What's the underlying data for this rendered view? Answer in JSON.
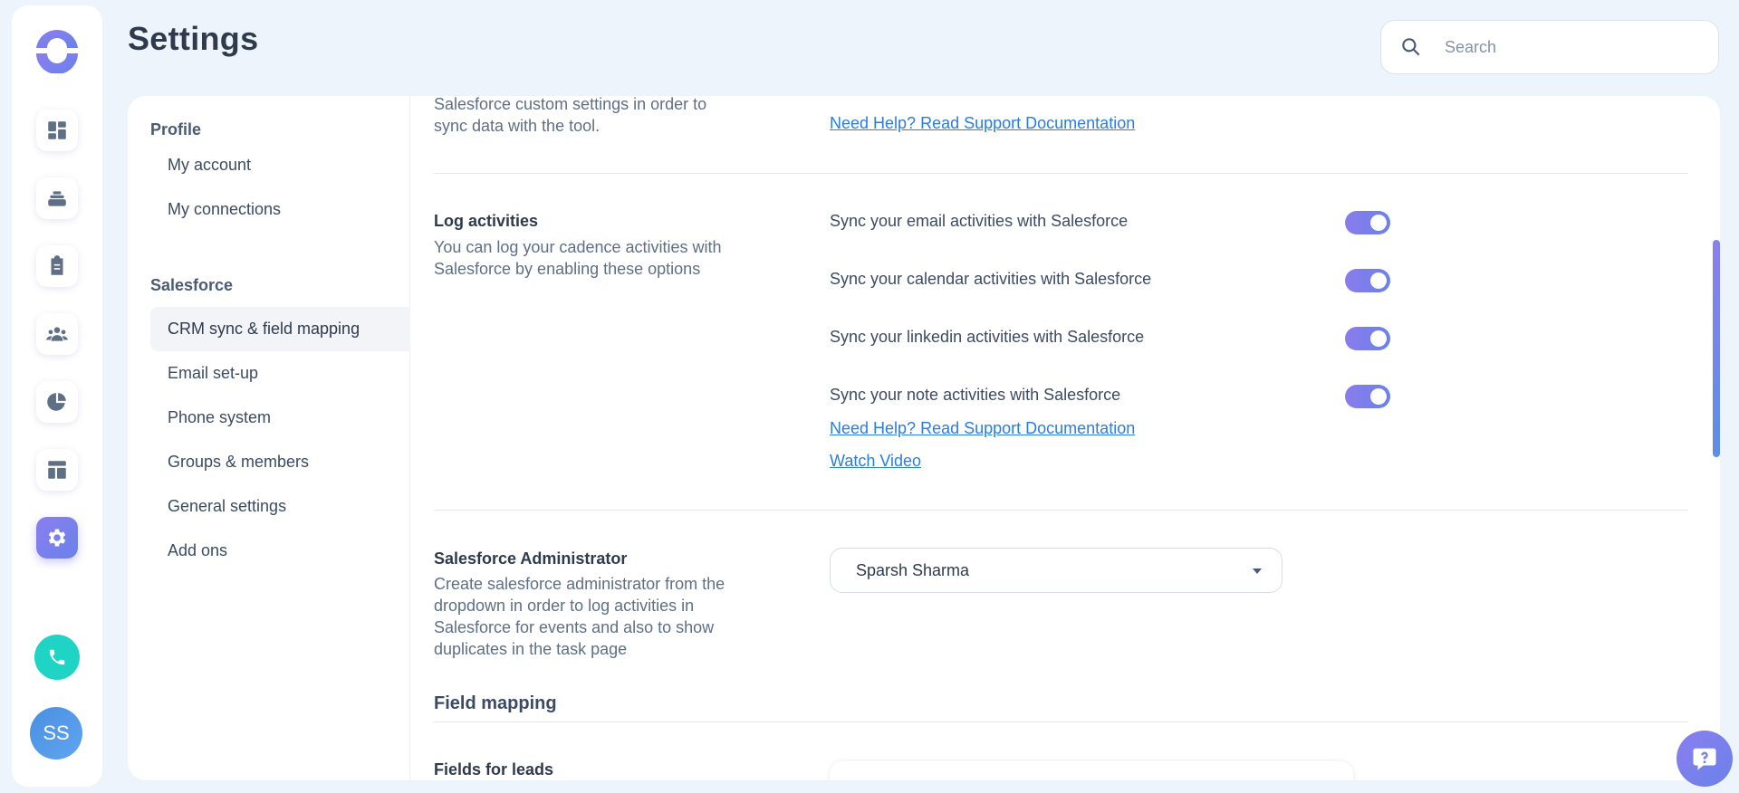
{
  "header": {
    "title": "Settings",
    "search_placeholder": "Search"
  },
  "rail": {
    "icons": [
      "dashboard-icon",
      "cadence-icon",
      "tasks-icon",
      "people-icon",
      "reports-icon",
      "templates-icon",
      "settings-icon"
    ],
    "active": "settings-icon",
    "avatar_initials": "SS",
    "accent": "#7b80ec",
    "phone_color": "#1fd4c5"
  },
  "subnav": {
    "profile_heading": "Profile",
    "profile_items": [
      "My account",
      "My connections"
    ],
    "salesforce_heading": "Salesforce",
    "salesforce_items": [
      "CRM sync & field mapping",
      "Email set-up",
      "Phone system",
      "Groups & members",
      "General settings",
      "Add ons"
    ],
    "active_item": "CRM sync & field mapping"
  },
  "content": {
    "top_desc": "Salesforce custom settings in order to sync data with the tool.",
    "top_link": "Need Help? Read Support Documentation",
    "log_activities": {
      "title": "Log activities",
      "desc": "You can log your cadence activities with Salesforce by enabling these options",
      "options": [
        {
          "label": "Sync your email activities with Salesforce",
          "enabled": true
        },
        {
          "label": "Sync your calendar activities with Salesforce",
          "enabled": true
        },
        {
          "label": "Sync your linkedin activities with Salesforce",
          "enabled": true
        },
        {
          "label": "Sync your note activities with Salesforce",
          "enabled": true
        }
      ],
      "help_link": "Need Help? Read Support Documentation",
      "video_link": "Watch Video"
    },
    "admin": {
      "title": "Salesforce Administrator",
      "desc": "Create salesforce administrator from the dropdown in order to log activities in Salesforce for events and also to show duplicates in the task page",
      "selected": "Sparsh Sharma"
    },
    "field_mapping_title": "Field mapping",
    "fields_for_leads": "Fields for leads"
  }
}
